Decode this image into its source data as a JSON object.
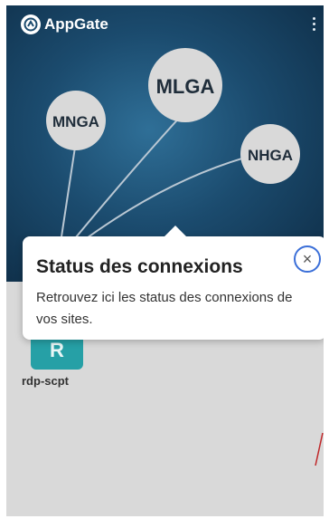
{
  "app": {
    "brand": "AppGate",
    "logo_icon": "appgate-logo-icon",
    "menu_icon": "kebab-menu-icon"
  },
  "graph": {
    "nodes": [
      {
        "id": "mlga",
        "label": "MLGA"
      },
      {
        "id": "mnga",
        "label": "MNGA"
      },
      {
        "id": "nhga",
        "label": "NHGA"
      }
    ]
  },
  "tooltip": {
    "title": "Status des connexions",
    "text": "Retrouvez ici les status des connexions de vos sites.",
    "close_label": "×"
  },
  "site": {
    "initial": "R",
    "label": "rdp-scpt"
  },
  "colors": {
    "header_dark": "#0e2c45",
    "header_light": "#2f6f97",
    "node_fill": "#d9d9d9",
    "tile": "#26a0a6",
    "close_border": "#3b6fd8"
  }
}
